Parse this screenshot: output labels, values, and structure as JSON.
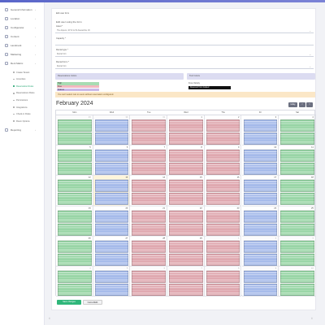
{
  "sidebar": {
    "items": [
      {
        "label": "General Information",
        "icon": "info-icon",
        "expandable": true
      },
      {
        "label": "Location",
        "icon": "location-icon",
        "expandable": true
      },
      {
        "label": "Configurator",
        "icon": "sliders-icon",
        "expandable": true
      },
      {
        "label": "Content",
        "icon": "document-icon",
        "expandable": true
      },
      {
        "label": "Landmark",
        "icon": "landmark-icon",
        "expandable": true
      },
      {
        "label": "Marketing",
        "icon": "megaphone-icon",
        "expandable": true
      },
      {
        "label": "Rent Matrix",
        "icon": "grid-icon",
        "expandable": true
      }
    ],
    "sub_items": [
      {
        "label": "Create Tenant",
        "active": false
      },
      {
        "label": "Amenities",
        "active": false
      },
      {
        "label": "Reservation Rules",
        "active": true
      },
      {
        "label": "Reservations Rules",
        "active": false
      },
      {
        "label": "Permissions",
        "active": false
      },
      {
        "label": "Integrations",
        "active": false
      },
      {
        "label": "Check-in Rules",
        "active": false
      },
      {
        "label": "Room Options",
        "active": false
      }
    ],
    "bottom_item": {
      "label": "Reporting",
      "icon": "chart-icon"
    }
  },
  "form": {
    "heading": "Edit user form",
    "subheading": "Edit user using the form",
    "asset_label": "Asset *",
    "asset_value": "The Aspens, 42 W 1st St Alexandria, VA",
    "capacity_label": "Capacity *",
    "rental_type_label": "Rental type *",
    "rental_type_value": "Rental Unit",
    "rental_form_label": "Rental Form *",
    "rental_form_value": "Rental Unit"
  },
  "panels": {
    "left_title": "Reservations Colors",
    "right_title": "Tool Colors"
  },
  "legend": [
    {
      "label": "High",
      "color": "#a8dcb3"
    },
    {
      "label": "Free",
      "color": "#f2b8c0"
    },
    {
      "label": "Spaces",
      "color": "#c9b8e8"
    }
  ],
  "right_legend": {
    "label": "Free Variety",
    "bar_text": "Reserved from booked"
  },
  "warning": "You can't select rule to users without reservation configured.",
  "calendar": {
    "title": "February 2024",
    "nav": {
      "today_label": "today",
      "prev_label": "<",
      "next_label": ">"
    },
    "day_headers": [
      "Mon",
      "Wed",
      "Tue",
      "Wed",
      "Thu",
      "Fri",
      "Sat"
    ],
    "weeks": [
      [
        {
          "day": "29",
          "other": true,
          "events": [
            "green",
            "green"
          ]
        },
        {
          "day": "30",
          "other": true,
          "events": [
            "blue",
            "blue"
          ]
        },
        {
          "day": "31",
          "other": true,
          "events": [
            "red",
            "red"
          ]
        },
        {
          "day": "1",
          "other": false,
          "events": [
            "red",
            "red"
          ]
        },
        {
          "day": "2",
          "other": false,
          "events": [
            "red",
            "red"
          ]
        },
        {
          "day": "3",
          "other": false,
          "events": [
            "blue",
            "blue"
          ]
        },
        {
          "day": "4",
          "other": false,
          "events": [
            "green",
            "green"
          ]
        }
      ],
      [
        {
          "day": "5",
          "other": false,
          "events": [
            "green",
            "green"
          ]
        },
        {
          "day": "6",
          "other": false,
          "events": [
            "blue",
            "blue"
          ]
        },
        {
          "day": "7",
          "other": false,
          "events": [
            "red",
            "red"
          ]
        },
        {
          "day": "8",
          "other": false,
          "events": [
            "red",
            "red"
          ]
        },
        {
          "day": "9",
          "other": false,
          "events": [
            "red",
            "red"
          ]
        },
        {
          "day": "10",
          "other": false,
          "events": [
            "blue",
            "blue"
          ]
        },
        {
          "day": "11",
          "other": false,
          "events": [
            "green",
            "green"
          ]
        }
      ],
      [
        {
          "day": "12",
          "other": false,
          "events": [
            "green",
            "green"
          ]
        },
        {
          "day": "13",
          "other": false,
          "today": true,
          "events": [
            "blue",
            "blue"
          ]
        },
        {
          "day": "14",
          "other": false,
          "events": [
            "red",
            "red"
          ]
        },
        {
          "day": "15",
          "other": false,
          "events": [
            "red",
            "red"
          ]
        },
        {
          "day": "16",
          "other": false,
          "events": [
            "red",
            "red"
          ]
        },
        {
          "day": "17",
          "other": false,
          "events": [
            "blue",
            "blue"
          ]
        },
        {
          "day": "18",
          "other": false,
          "events": [
            "green",
            "green"
          ]
        }
      ],
      [
        {
          "day": "19",
          "other": false,
          "events": [
            "green",
            "green"
          ]
        },
        {
          "day": "20",
          "other": false,
          "events": [
            "blue",
            "blue"
          ]
        },
        {
          "day": "21",
          "other": false,
          "events": [
            "red",
            "red"
          ]
        },
        {
          "day": "22",
          "other": false,
          "events": [
            "red",
            "red"
          ]
        },
        {
          "day": "23",
          "other": false,
          "events": [
            "red",
            "red"
          ]
        },
        {
          "day": "24",
          "other": false,
          "events": [
            "blue",
            "blue"
          ]
        },
        {
          "day": "25",
          "other": false,
          "events": [
            "green",
            "green"
          ]
        }
      ],
      [
        {
          "day": "26",
          "other": false,
          "events": [
            "green",
            "green"
          ]
        },
        {
          "day": "27",
          "other": false,
          "events": [
            "blue",
            "blue"
          ]
        },
        {
          "day": "28",
          "other": false,
          "events": [
            "red",
            "red"
          ]
        },
        {
          "day": "29",
          "other": false,
          "events": [
            "red",
            "red"
          ]
        },
        {
          "day": "1",
          "other": true,
          "events": [
            "red",
            "red"
          ]
        },
        {
          "day": "2",
          "other": true,
          "events": [
            "blue",
            "blue"
          ]
        },
        {
          "day": "3",
          "other": true,
          "events": [
            "green",
            "green"
          ]
        }
      ],
      [
        {
          "day": "4",
          "other": true,
          "events": [
            "green",
            "green"
          ]
        },
        {
          "day": "5",
          "other": true,
          "events": [
            "blue",
            "blue"
          ]
        },
        {
          "day": "6",
          "other": true,
          "events": [
            "red",
            "red"
          ]
        },
        {
          "day": "7",
          "other": true,
          "events": [
            "red",
            "red"
          ]
        },
        {
          "day": "8",
          "other": true,
          "events": [
            "red",
            "red"
          ]
        },
        {
          "day": "9",
          "other": true,
          "events": [
            "blue",
            "blue"
          ]
        },
        {
          "day": "10",
          "other": true,
          "events": [
            "green",
            "green"
          ]
        }
      ]
    ]
  },
  "actions": {
    "save_label": "Save changes",
    "cancel_label": "Cancel/Edit"
  },
  "footer": {
    "left": "©",
    "right": "©"
  },
  "colors": {
    "accent": "#2fb67a",
    "event_green": "#8fd19e",
    "event_blue": "#9db4e8",
    "event_red": "#dca0a8",
    "today_bg": "#fdf5dc"
  }
}
